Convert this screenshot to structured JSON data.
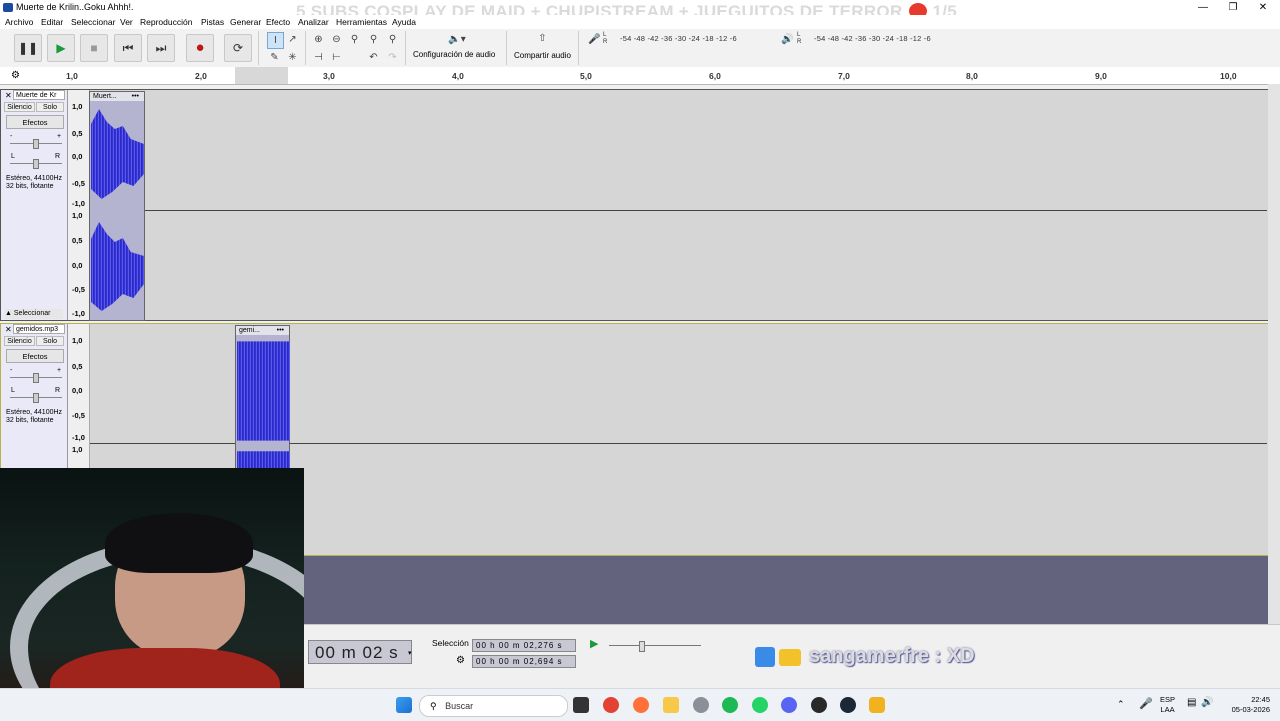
{
  "window": {
    "title": "Muerte de Krilin..Goku Ahhh!.",
    "stream_overlay_title": "5 SUBS COSPLAY DE MAID + CHUPISTREAM + JUEGUITOS DE TERROR",
    "stream_overlay_count": "1/5"
  },
  "menu": [
    "Archivo",
    "Editar",
    "Seleccionar",
    "Ver",
    "Reproducción",
    "Pistas",
    "Generar",
    "Efecto",
    "Analizar",
    "Herramientas",
    "Ayuda"
  ],
  "toolbar": {
    "audio_setup_label": "Configuración de audio",
    "share_audio_label": "Compartir audio",
    "record_meter_scale": "-54 -48 -42 -36 -30 -24 -18 -12 -6",
    "playback_meter_scale": "-54 -48 -42 -36 -30 -24 -18 -12 -6",
    "meter_l": "L",
    "meter_r": "R"
  },
  "ruler": {
    "ticks": [
      "1,0",
      "2,0",
      "3,0",
      "4,0",
      "5,0",
      "6,0",
      "7,0",
      "8,0",
      "9,0",
      "10,0"
    ]
  },
  "tracks": [
    {
      "name": "Muerte de Kr",
      "clip_name": "Muert...",
      "clip_menu": "•••",
      "mute_label": "Silencio",
      "solo_label": "Solo",
      "effects_label": "Efectos",
      "info_line1": "Estéreo, 44100Hz",
      "info_line2": "32 bits, flotante",
      "select_label": "Seleccionar",
      "scale_ch1": [
        "1,0",
        "0,5",
        "0,0",
        "-0,5",
        "-1,0"
      ],
      "scale_ch2": [
        "1,0",
        "0,5",
        "0,0",
        "-0,5",
        "-1,0"
      ]
    },
    {
      "name": "gemidos.mp3",
      "clip_name": "gemi...",
      "clip_menu": "•••",
      "mute_label": "Silencio",
      "solo_label": "Solo",
      "effects_label": "Efectos",
      "info_line1": "Estéreo, 44100Hz",
      "info_line2": "32 bits, flotante",
      "scale_ch1": [
        "1,0",
        "0,5",
        "0,0",
        "-0,5",
        "-1,0"
      ],
      "scale_ch2": [
        "1,0"
      ]
    }
  ],
  "selection": {
    "label": "Selección",
    "start": "00 h 00 m 02,276 s",
    "end": "00 h 00 m 02,694 s",
    "big_time": "00 m 02 s"
  },
  "overlay_watermark": "sangamerfre : XD",
  "taskbar": {
    "search_placeholder": "Buscar",
    "lang_line1": "ESP",
    "lang_line2": "LAA",
    "time": "22:45",
    "date": "05-03-2026"
  }
}
